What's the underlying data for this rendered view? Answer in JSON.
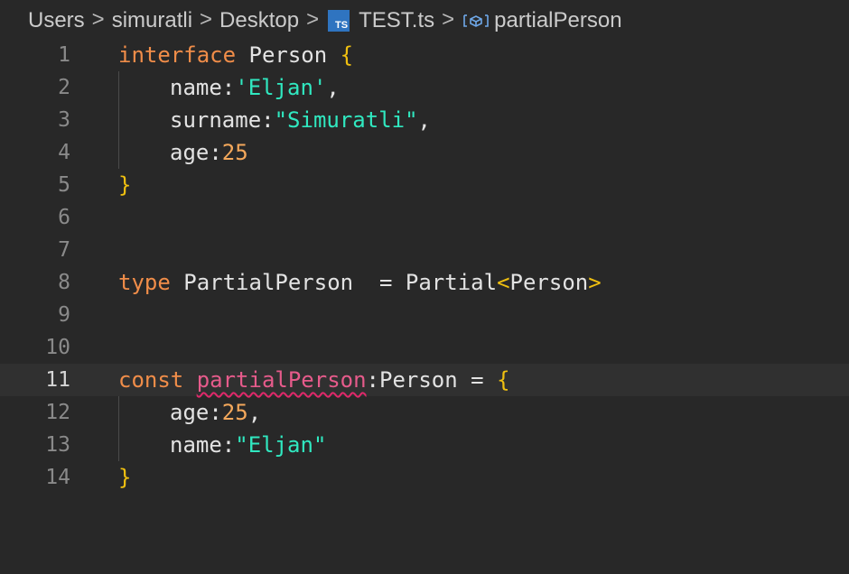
{
  "breadcrumb": {
    "items": [
      "Users",
      "simuratli",
      "Desktop"
    ],
    "file_name": "TEST.ts",
    "file_icon_label": "TS",
    "file_icon": "typescript-file-icon",
    "symbol_icon": "variable-symbol-icon",
    "symbol_name": "partialPerson",
    "separator": ">"
  },
  "editor": {
    "current_line": 11,
    "line_numbers": [
      "1",
      "2",
      "3",
      "4",
      "5",
      "6",
      "7",
      "8",
      "9",
      "10",
      "11",
      "12",
      "13",
      "14"
    ],
    "lines": {
      "l1": {
        "kw": "interface",
        "name": "Person",
        "brace": "{"
      },
      "l2": {
        "key": "name:",
        "value": "'Eljan'",
        "punct": ","
      },
      "l3": {
        "key": "surname:",
        "value": "\"Simuratli\"",
        "punct": ","
      },
      "l4": {
        "key": "age:",
        "value": "25"
      },
      "l5": {
        "brace": "}"
      },
      "l8": {
        "kw": "type",
        "name": "PartialPerson",
        "eq": "=",
        "generic": "Partial",
        "lt": "<",
        "arg": "Person",
        "gt": ">"
      },
      "l11": {
        "kw": "const",
        "var": "partialPerson",
        "colon": ":",
        "type": "Person",
        "eq": "=",
        "brace": "{"
      },
      "l12": {
        "key": "age:",
        "value": "25",
        "punct": ","
      },
      "l13": {
        "key": "name:",
        "value": "\"Eljan\""
      },
      "l14": {
        "brace": "}"
      }
    }
  },
  "colors": {
    "background": "#282828",
    "keyword": "#f08d49",
    "string": "#30e8c0",
    "number": "#f4a85b",
    "brace": "#f0c010",
    "error_underline": "#e0286a"
  }
}
